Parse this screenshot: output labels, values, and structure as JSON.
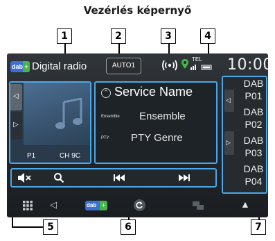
{
  "caption": "Vezérlés képernyő",
  "callouts": [
    "1",
    "2",
    "3",
    "4",
    "5",
    "6",
    "7"
  ],
  "status_bar": {
    "source_logo": "dab",
    "source_logo_plus": "+",
    "app_title": "Digital radio",
    "preset_mode": "AUTO1",
    "signal_label": "((•))",
    "tel_label": "TEL",
    "clock": "10:00"
  },
  "artwork_panel": {
    "preset_number": "P1",
    "channel": "CH 9C",
    "left_arrow": "◁",
    "right_arrow": "▷"
  },
  "info_panel": {
    "service_name": "Service Name",
    "ensemble_label": "Ensemble",
    "ensemble_value": "Ensemble",
    "pty_label": "PTY",
    "pty_value": "PTY Genre"
  },
  "preset_list": {
    "left_arrow": "◁",
    "right_arrow": "▷",
    "items": [
      {
        "band": "DAB",
        "preset": "P01"
      },
      {
        "band": "DAB",
        "preset": "P02"
      },
      {
        "band": "DAB",
        "preset": "P03"
      },
      {
        "band": "DAB",
        "preset": "P04"
      }
    ]
  },
  "controls": {
    "mute": "◀×",
    "search": "🔍",
    "prev": "◀◀",
    "next": "▶▶"
  },
  "bottom_bar": {
    "menu": "⋮⋮⋮",
    "back": "◁",
    "source_logo": "dab",
    "source_logo_plus": "+",
    "eject": "▲"
  },
  "colors": {
    "highlight_border": "#4aa8e8",
    "screen_bg": "#24282c",
    "dab_blue": "#3b6fd6",
    "dab_green": "#45b649"
  }
}
